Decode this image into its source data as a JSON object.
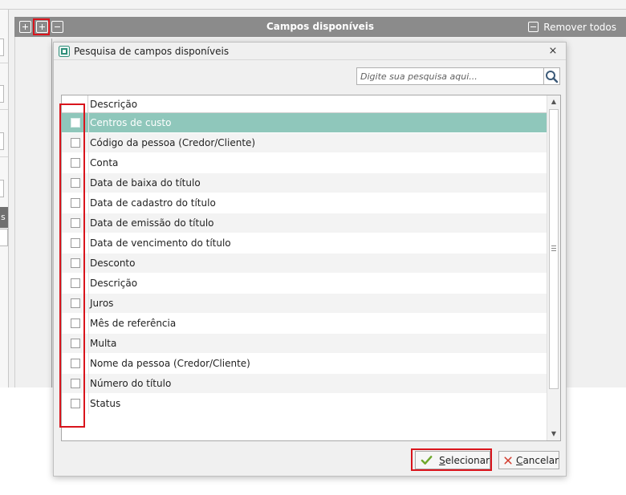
{
  "background": {
    "header_title": "Campos disponíveis",
    "remove_all_label": "Remover todos",
    "sidebar_dark_text": "s"
  },
  "dialog": {
    "title": "Pesquisa de campos disponíveis",
    "close_glyph": "⨯",
    "search": {
      "placeholder": "Digite sua pesquisa aqui..."
    },
    "grid": {
      "column_description": "Descrição",
      "rows": [
        {
          "label": "Centros de custo",
          "checked": false,
          "selected": true
        },
        {
          "label": "Código da pessoa (Credor/Cliente)",
          "checked": false,
          "selected": false
        },
        {
          "label": "Conta",
          "checked": false,
          "selected": false
        },
        {
          "label": "Data de baixa do título",
          "checked": false,
          "selected": false
        },
        {
          "label": "Data de cadastro do título",
          "checked": false,
          "selected": false
        },
        {
          "label": "Data de emissão do título",
          "checked": false,
          "selected": false
        },
        {
          "label": "Data de vencimento do título",
          "checked": false,
          "selected": false
        },
        {
          "label": "Desconto",
          "checked": false,
          "selected": false
        },
        {
          "label": "Descrição",
          "checked": false,
          "selected": false
        },
        {
          "label": "Juros",
          "checked": false,
          "selected": false
        },
        {
          "label": "Mês de referência",
          "checked": false,
          "selected": false
        },
        {
          "label": "Multa",
          "checked": false,
          "selected": false
        },
        {
          "label": "Nome da pessoa (Credor/Cliente)",
          "checked": false,
          "selected": false
        },
        {
          "label": "Número do título",
          "checked": false,
          "selected": false
        },
        {
          "label": "Status",
          "checked": false,
          "selected": false
        }
      ]
    },
    "buttons": {
      "select_mnemonic": "S",
      "select_rest": "elecionar",
      "cancel_mnemonic": "C",
      "cancel_rest": "ancelar"
    }
  },
  "colors": {
    "selected_row": "#8fc7bb",
    "highlight_red": "#d9141c",
    "header_gray": "#8b8b8b",
    "ok_check": "#6ea82c",
    "cancel_x": "#d23a2c"
  },
  "icons": {
    "add": "plus-box-icon",
    "remove": "minus-box-icon",
    "search": "magnifier-icon",
    "confirm": "check-icon",
    "cancel": "x-icon"
  }
}
